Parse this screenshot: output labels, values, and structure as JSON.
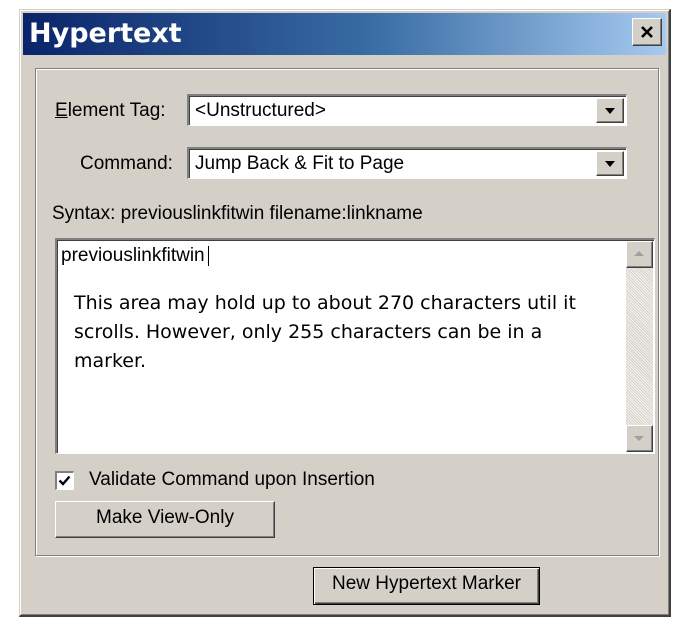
{
  "window": {
    "title": "Hypertext",
    "close_glyph": "✕"
  },
  "form": {
    "element_tag": {
      "label_mnemonic": "E",
      "label_rest": "lement Tag:",
      "value": "<Unstructured>"
    },
    "command": {
      "label": "Command:",
      "value": "Jump Back & Fit to Page"
    },
    "syntax": "Syntax:  previouslinkfitwin filename:linkname",
    "textarea": {
      "text": "previouslinkfitwin",
      "note": "This area may hold up to about 270 characters util it scrolls. However, only 255 characters can be in a marker."
    },
    "validate": {
      "label": "Validate Command upon Insertion",
      "checked": true,
      "check_glyph": "✔"
    },
    "make_view_only_label": "Make View-Only"
  },
  "footer": {
    "new_marker_label": "New Hypertext Marker"
  },
  "icons": {
    "close": "close-icon",
    "dropdown": "chevron-down-icon",
    "scroll_up": "arrow-up-icon",
    "scroll_down": "arrow-down-icon",
    "check": "check-icon"
  }
}
